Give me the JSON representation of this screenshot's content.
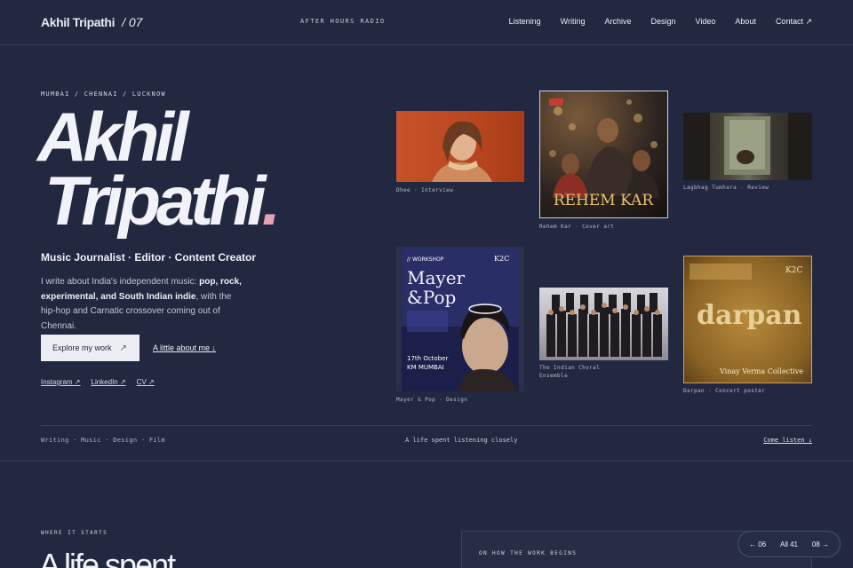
{
  "header": {
    "name": "Akhil Tripathi",
    "issue": "/ 07",
    "station": "AFTER HOURS RADIO",
    "nav": [
      "Listening",
      "Writing",
      "Archive",
      "Design",
      "Video",
      "About",
      "Contact ↗"
    ]
  },
  "hero": {
    "cities": "MUMBAI / CHENNAI / LUCKNOW",
    "name_line1": "Akhil",
    "name_line2": "Tripathi",
    "name_dot": ".",
    "roles": "Music Journalist · Editor · Content Creator",
    "intro_a": "I write about India's independent music: ",
    "intro_b": "pop, rock, experimental, and South Indian indie",
    "intro_c": ", with the hip-hop and Carnatic crossover coming out of Chennai.",
    "primary_button": "Explore my work",
    "primary_arrow": "↗",
    "about_link": "A little about me ↓",
    "social": [
      "Instagram ↗",
      "LinkedIn ↗",
      "CV ↗"
    ]
  },
  "gallery": [
    {
      "caption": "Dhee · Interview"
    },
    {
      "caption": "Rehem Kar · Cover art",
      "poster_title": "REHEM KAR"
    },
    {
      "caption": "Lagbhag Tumhara · Review"
    },
    {
      "caption": "Mayer & Pop · Design",
      "poster_tag": "// WORKSHOP",
      "poster_title_1": "Mayer",
      "poster_title_2": "&Pop",
      "poster_date": "17th October",
      "poster_place": "KM MUMBAI",
      "poster_badge": "K2C"
    },
    {
      "caption_1": "The Indian Choral",
      "caption_2": "Ensemble"
    },
    {
      "caption": "Darpan · Concert poster",
      "poster_title": "darpan",
      "poster_credit": "Vinay Verma Collective",
      "poster_badge": "K2C"
    }
  ],
  "strip": {
    "tags": "Writing · Music · Design · Film",
    "tagline": "A life spent listening closely",
    "cta": "Come listen ↓"
  },
  "section2": {
    "eyebrow": "WHERE IT STARTS",
    "heading": "A life spent",
    "panel_label": "ON HOW THE WORK BEGINS"
  },
  "pager": {
    "prev": "← 06",
    "all": "All 41",
    "next": "08 →"
  }
}
